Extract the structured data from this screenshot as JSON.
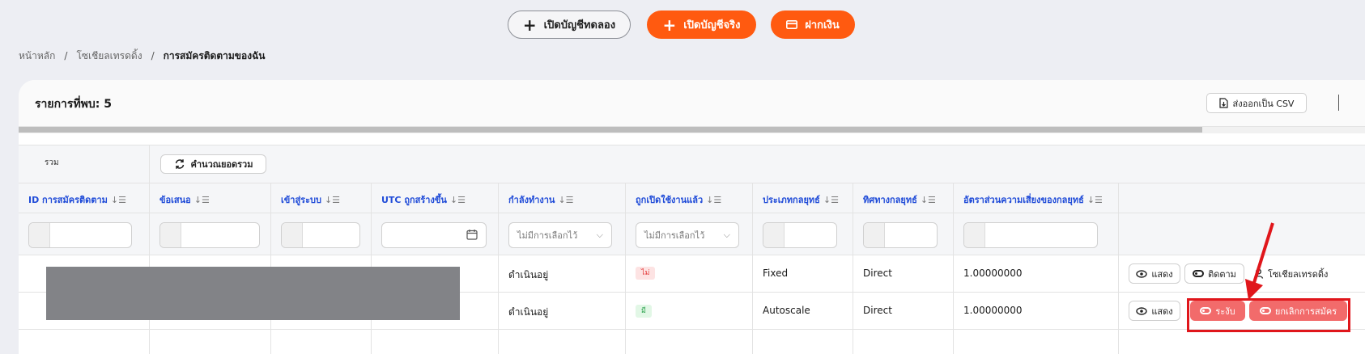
{
  "topbar": {
    "demo_label": "เปิดบัญชีทดลอง",
    "real_label": "เปิดบัญชีจริง",
    "deposit_label": "ฝากเงิน"
  },
  "breadcrumb": {
    "items": [
      "หน้าหลัก",
      "โซเชียลเทรดดิ้ง"
    ],
    "current": "การสมัครติดตามของฉัน"
  },
  "card": {
    "count_label": "รายการที่พบ: 5",
    "export_label": "ส่งออกเป็น CSV"
  },
  "table": {
    "total_label": "รวม",
    "calc_label": "คำนวณยอดรวม",
    "headers": [
      "ID การสมัครติดตาม",
      "ข้อเสนอ",
      "เข้าสู่ระบบ",
      "UTC ถูกสร้างขึ้น",
      "กำลังทำงาน",
      "ถูกเปิดใช้งานแล้ว",
      "ประเภทกลยุทธ์",
      "ทิศทางกลยุทธ์",
      "อัตราส่วนความเสี่ยงของกลยุทธ์"
    ],
    "filter_placeholder": "ไม่มีการเลือกไว้",
    "rows": [
      {
        "status": "ดำเนินอยู่",
        "enabled": "ไม่",
        "type": "Fixed",
        "direction": "Direct",
        "risk": "1.00000000",
        "actions": [
          "แสดง",
          "ติดตาม",
          "โซเชียลเทรดดิ้ง"
        ]
      },
      {
        "status": "ดำเนินอยู่",
        "enabled": "มี",
        "type": "Autoscale",
        "direction": "Direct",
        "risk": "1.00000000",
        "actions": [
          "แสดง",
          "ระงับ",
          "ยกเลิกการสมัคร"
        ]
      }
    ]
  },
  "colors": {
    "accent": "#ff5a10",
    "link_header": "#1f4bd8",
    "danger_button": "#f26b6b",
    "highlight": "#e0161b"
  }
}
